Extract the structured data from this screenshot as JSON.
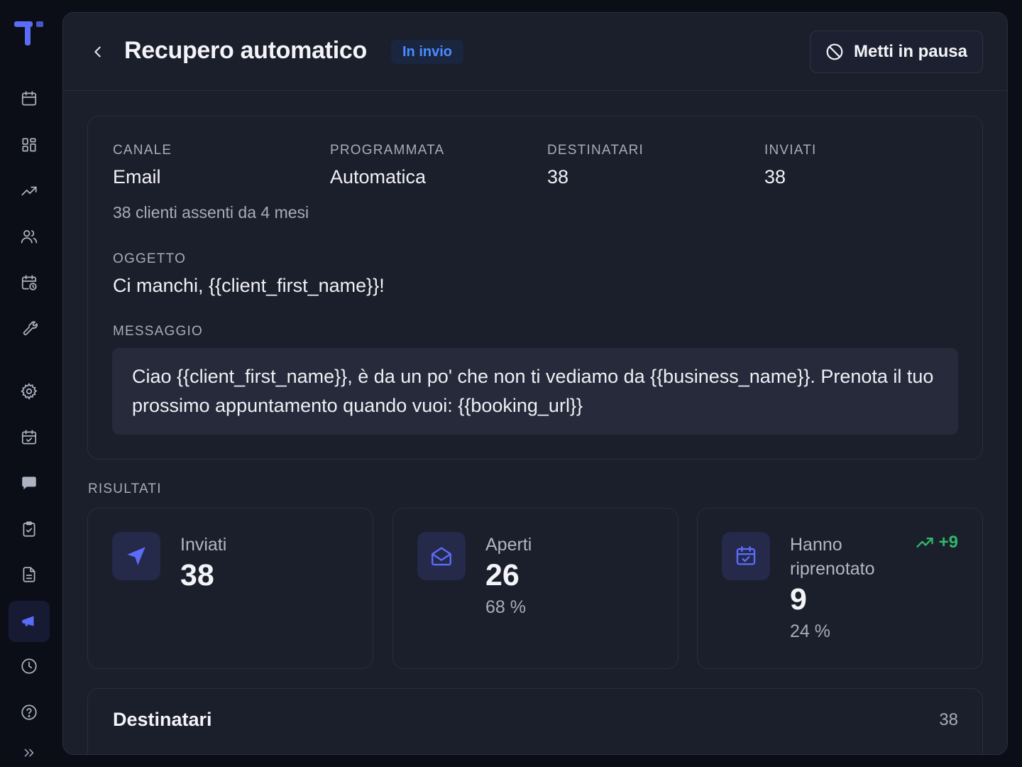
{
  "header": {
    "title": "Recupero automatico",
    "status": "In invio",
    "pause_label": "Metti in pausa"
  },
  "details": {
    "channel_label": "CANALE",
    "channel_value": "Email",
    "scheduled_label": "PROGRAMMATA",
    "scheduled_value": "Automatica",
    "recipients_label": "DESTINATARI",
    "recipients_value": "38",
    "sent_label": "INVIATI",
    "sent_value": "38",
    "audience": "38 clienti assenti da 4 mesi",
    "subject_label": "OGGETTO",
    "subject_value": "Ci manchi, {{client_first_name}}!",
    "message_label": "MESSAGGIO",
    "message_value": "Ciao {{client_first_name}}, è da un po' che non ti vediamo da {{business_name}}. Prenota il tuo prossimo appuntamento quando vuoi: {{booking_url}}"
  },
  "results": {
    "section_label": "RISULTATI",
    "sent": {
      "label": "Inviati",
      "value": "38"
    },
    "opened": {
      "label": "Aperti",
      "value": "26",
      "pct": "68 %"
    },
    "rebooked": {
      "label_line1": "Hanno",
      "label_line2": "riprenotato",
      "value": "9",
      "pct": "24 %",
      "trend": "+9"
    }
  },
  "recipients": {
    "title": "Destinatari",
    "count": "38"
  },
  "colors": {
    "accent": "#5b6cf9",
    "status_badge": "#4a8cff",
    "trend_up": "#2fb86a",
    "background": "#1b1e2b"
  },
  "icons": {
    "sidebar": [
      "calendar-icon",
      "dashboard-icon",
      "trending-up-icon",
      "users-icon",
      "calendar-clock-icon",
      "wrench-icon",
      "gear-icon",
      "calendar-check-icon",
      "chat-icon",
      "clipboard-check-icon",
      "document-icon",
      "megaphone-icon",
      "clock-icon",
      "help-icon",
      "chevrons-right-icon"
    ]
  }
}
